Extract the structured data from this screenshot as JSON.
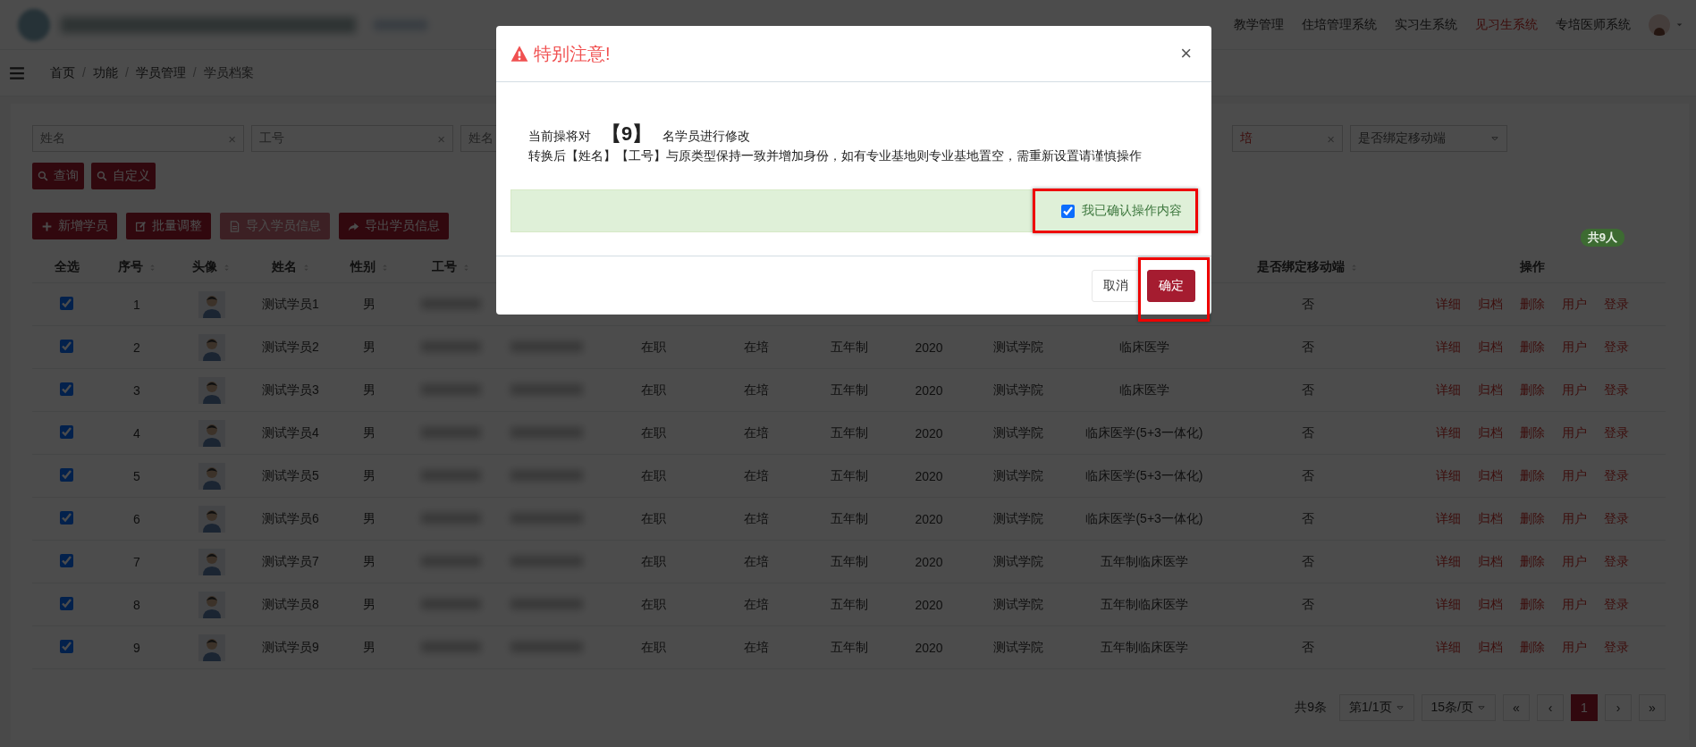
{
  "topbar": {
    "nav": [
      {
        "label": "教学管理",
        "selected": false
      },
      {
        "label": "住培管理系统",
        "selected": false
      },
      {
        "label": "实习生系统",
        "selected": false
      },
      {
        "label": "见习生系统",
        "selected": true
      },
      {
        "label": "专培医师系统",
        "selected": false
      }
    ]
  },
  "breadcrumb": [
    {
      "label": "首页",
      "separator": "/"
    },
    {
      "label": "功能",
      "separator": "/"
    },
    {
      "label": "学员管理",
      "separator": "/"
    },
    {
      "label": "学员档案"
    }
  ],
  "filters": [
    {
      "kind": "text",
      "placeholder": "姓名",
      "clear": "×"
    },
    {
      "kind": "text",
      "placeholder": "工号",
      "clear": "×"
    },
    {
      "kind": "text",
      "placeholder": "姓名"
    },
    {
      "kind": "clearable",
      "value": "培",
      "clear": "×"
    },
    {
      "kind": "select",
      "value": "是否绑定移动端"
    }
  ],
  "query_buttons": [
    {
      "label": "查询",
      "kind": "search"
    },
    {
      "label": "自定义",
      "kind": "search"
    }
  ],
  "actions": [
    {
      "label": "新增学员",
      "kind": "plus",
      "disabled": false
    },
    {
      "label": "批量调整",
      "kind": "edit",
      "disabled": false
    },
    {
      "label": "导入学员信息",
      "kind": "file",
      "disabled": true
    },
    {
      "label": "导出学员信息",
      "kind": "share",
      "disabled": false
    }
  ],
  "total_badge": "共9人",
  "table": {
    "columns_left": [
      {
        "label": "全选",
        "sortable": false
      },
      {
        "label": "序号",
        "sortable": true
      },
      {
        "label": "头像",
        "sortable": true
      },
      {
        "label": "姓名",
        "sortable": true
      },
      {
        "label": "性别",
        "sortable": true
      },
      {
        "label": "工号",
        "sortable": true
      }
    ],
    "columns_right": [
      {
        "label": "是否绑定移动端",
        "sortable": true
      },
      {
        "label": "操作",
        "sortable": false
      }
    ],
    "rows": [
      {
        "checked": true,
        "index": "1",
        "name": "测试学员1",
        "gender": "男",
        "mobile": "否",
        "ops": [
          "详细",
          "归档",
          "删除",
          "用户",
          "登录"
        ]
      },
      {
        "checked": true,
        "index": "2",
        "name": "测试学员2",
        "gender": "男",
        "status": "在职",
        "training": "在培",
        "system": "五年制",
        "year": "2020",
        "college": "测试学院",
        "major": "临床医学",
        "mobile": "否",
        "ops": [
          "详细",
          "归档",
          "删除",
          "用户",
          "登录"
        ]
      },
      {
        "checked": true,
        "index": "3",
        "name": "测试学员3",
        "gender": "男",
        "status": "在职",
        "training": "在培",
        "system": "五年制",
        "year": "2020",
        "college": "测试学院",
        "major": "临床医学",
        "mobile": "否",
        "ops": [
          "详细",
          "归档",
          "删除",
          "用户",
          "登录"
        ]
      },
      {
        "checked": true,
        "index": "4",
        "name": "测试学员4",
        "gender": "男",
        "status": "在职",
        "training": "在培",
        "system": "五年制",
        "year": "2020",
        "college": "测试学院",
        "major": "临床医学(5+3一体化)",
        "mobile": "否",
        "ops": [
          "详细",
          "归档",
          "删除",
          "用户",
          "登录"
        ]
      },
      {
        "checked": true,
        "index": "5",
        "name": "测试学员5",
        "gender": "男",
        "status": "在职",
        "training": "在培",
        "system": "五年制",
        "year": "2020",
        "college": "测试学院",
        "major": "临床医学(5+3一体化)",
        "mobile": "否",
        "ops": [
          "详细",
          "归档",
          "删除",
          "用户",
          "登录"
        ]
      },
      {
        "checked": true,
        "index": "6",
        "name": "测试学员6",
        "gender": "男",
        "status": "在职",
        "training": "在培",
        "system": "五年制",
        "year": "2020",
        "college": "测试学院",
        "major": "临床医学(5+3一体化)",
        "mobile": "否",
        "ops": [
          "详细",
          "归档",
          "删除",
          "用户",
          "登录"
        ]
      },
      {
        "checked": true,
        "index": "7",
        "name": "测试学员7",
        "gender": "男",
        "status": "在职",
        "training": "在培",
        "system": "五年制",
        "year": "2020",
        "college": "测试学院",
        "major": "五年制临床医学",
        "mobile": "否",
        "ops": [
          "详细",
          "归档",
          "删除",
          "用户",
          "登录"
        ]
      },
      {
        "checked": true,
        "index": "8",
        "name": "测试学员8",
        "gender": "男",
        "status": "在职",
        "training": "在培",
        "system": "五年制",
        "year": "2020",
        "college": "测试学院",
        "major": "五年制临床医学",
        "mobile": "否",
        "ops": [
          "详细",
          "归档",
          "删除",
          "用户",
          "登录"
        ]
      },
      {
        "checked": true,
        "index": "9",
        "name": "测试学员9",
        "gender": "男",
        "status": "在职",
        "training": "在培",
        "system": "五年制",
        "year": "2020",
        "college": "测试学院",
        "major": "五年制临床医学",
        "mobile": "否",
        "ops": [
          "详细",
          "归档",
          "删除",
          "用户",
          "登录"
        ]
      }
    ]
  },
  "pager": {
    "total": "共9条",
    "page_select": "第1/1页",
    "size_select": "15条/页",
    "buttons": [
      {
        "label": "«",
        "selected": false
      },
      {
        "label": "‹",
        "selected": false
      },
      {
        "label": "1",
        "selected": true
      },
      {
        "label": "›",
        "selected": false
      },
      {
        "label": "»",
        "selected": false
      }
    ]
  },
  "modal": {
    "title": "特别注意!",
    "close": "×",
    "line1": "当前操将对 **【9】** 名学员进行修改",
    "line2": "转换后【姓名】【工号】与原类型保持一致并增加身份，如有专业基地则专业基地置空，需重新设置请谨慎操作",
    "confirm": {
      "label": "我已确认操作内容",
      "checked": true,
      "highlighted": true
    },
    "buttons": [
      {
        "label": "取消",
        "kind": "default",
        "highlighted": false
      },
      {
        "label": "确定",
        "kind": "primary",
        "highlighted": true
      }
    ]
  }
}
